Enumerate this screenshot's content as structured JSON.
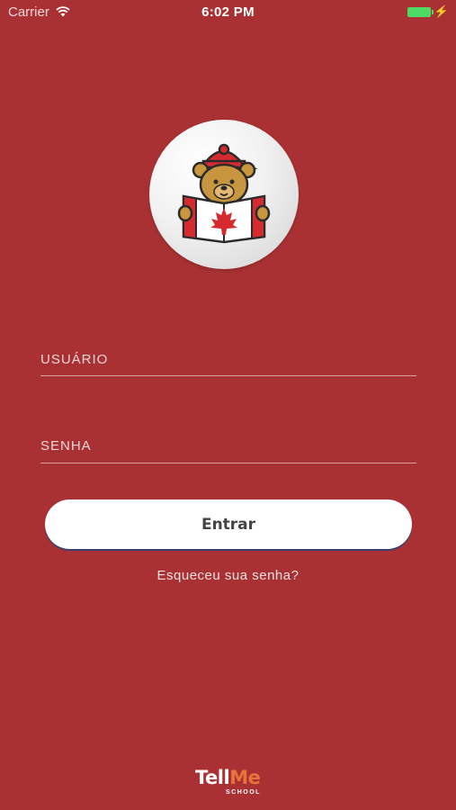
{
  "status_bar": {
    "carrier": "Carrier",
    "time": "6:02 PM",
    "wifi_icon": "wifi-icon",
    "battery_color": "#4cd964",
    "charge_icon": "⚡"
  },
  "logo": {
    "icon": "bear-reading-canada-flag-icon"
  },
  "form": {
    "user_placeholder": "USUÁRIO",
    "user_value": "",
    "pass_placeholder": "SENHA",
    "pass_value": "",
    "submit_label": "Entrar",
    "forgot_label": "Esqueceu sua senha?"
  },
  "brand": {
    "name_part1": "Tell",
    "name_part2": "Me",
    "subtitle": "SCHOOL"
  },
  "colors": {
    "background": "#a93134",
    "accent_orange": "#e8743a",
    "button_bg": "#ffffff"
  }
}
